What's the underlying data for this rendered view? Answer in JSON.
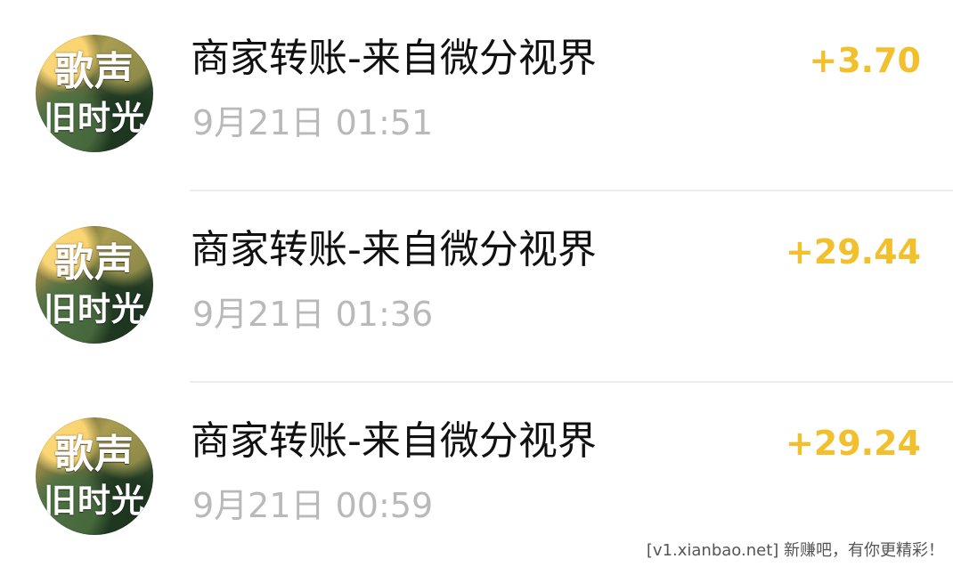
{
  "transactions": [
    {
      "avatar_line_1": "歌声",
      "avatar_line_2": "旧时光",
      "title": "商家转账-来自微分视界",
      "time": "9月21日 01:51",
      "amount": "+3.70"
    },
    {
      "avatar_line_1": "歌声",
      "avatar_line_2": "旧时光",
      "title": "商家转账-来自微分视界",
      "time": "9月21日 01:36",
      "amount": "+29.44"
    },
    {
      "avatar_line_1": "歌声",
      "avatar_line_2": "旧时光",
      "title": "商家转账-来自微分视界",
      "time": "9月21日 00:59",
      "amount": "+29.24"
    }
  ],
  "watermark": "[v1.xianbao.net] 新赚吧，有你更精彩！",
  "colors": {
    "amount": "#f2bf2d",
    "title": "#111111",
    "time": "#b9b9b9",
    "divider": "#ededed",
    "watermark": "#555555"
  }
}
